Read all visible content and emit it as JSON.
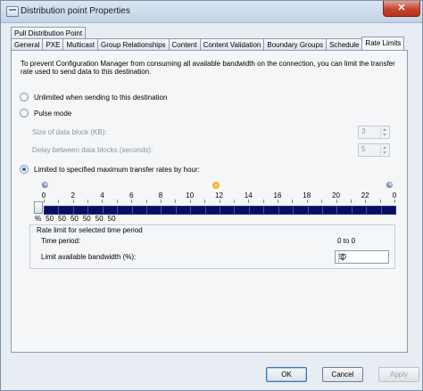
{
  "window": {
    "title": "Distribution point Properties",
    "close_glyph": "✕"
  },
  "tabs_top": [
    "Pull Distribution Point"
  ],
  "tabs_bottom": [
    "General",
    "PXE",
    "Multicast",
    "Group Relationships",
    "Content",
    "Content Validation",
    "Boundary Groups",
    "Schedule",
    "Rate Limits"
  ],
  "active_tab": "Rate Limits",
  "description": "To prevent Configuration Manager from consuming all available bandwidth on the connection, you can  limit the transfer rate used to send data to this destination.",
  "options": {
    "unlimited": "Unlimited when sending to this destination",
    "pulse": "Pulse mode",
    "limited": "Limited to specified maximum transfer rates by hour:",
    "selected": "limited"
  },
  "pulse": {
    "block_size_label": "Size of data block (KB):",
    "block_size_value": "3",
    "delay_label": "Delay between data blocks (seconds):",
    "delay_value": "5"
  },
  "schedule": {
    "hour_labels": [
      "0",
      "2",
      "4",
      "6",
      "8",
      "10",
      "12",
      "14",
      "16",
      "18",
      "20",
      "22",
      "0"
    ],
    "percent_symbol": "%",
    "percent_values": [
      "50",
      "50",
      "50",
      "50",
      "50",
      "50"
    ],
    "icons": [
      "moon-icon",
      "sun-icon",
      "moon-icon"
    ]
  },
  "rate_limit": {
    "group_title": "Rate limit for selected time period",
    "time_period_label": "Time period:",
    "time_period_value": "0 to 0",
    "bandwidth_label": "Limit available bandwidth (%):",
    "bandwidth_value": "50"
  },
  "buttons": {
    "ok": "OK",
    "cancel": "Cancel",
    "apply": "Apply"
  }
}
